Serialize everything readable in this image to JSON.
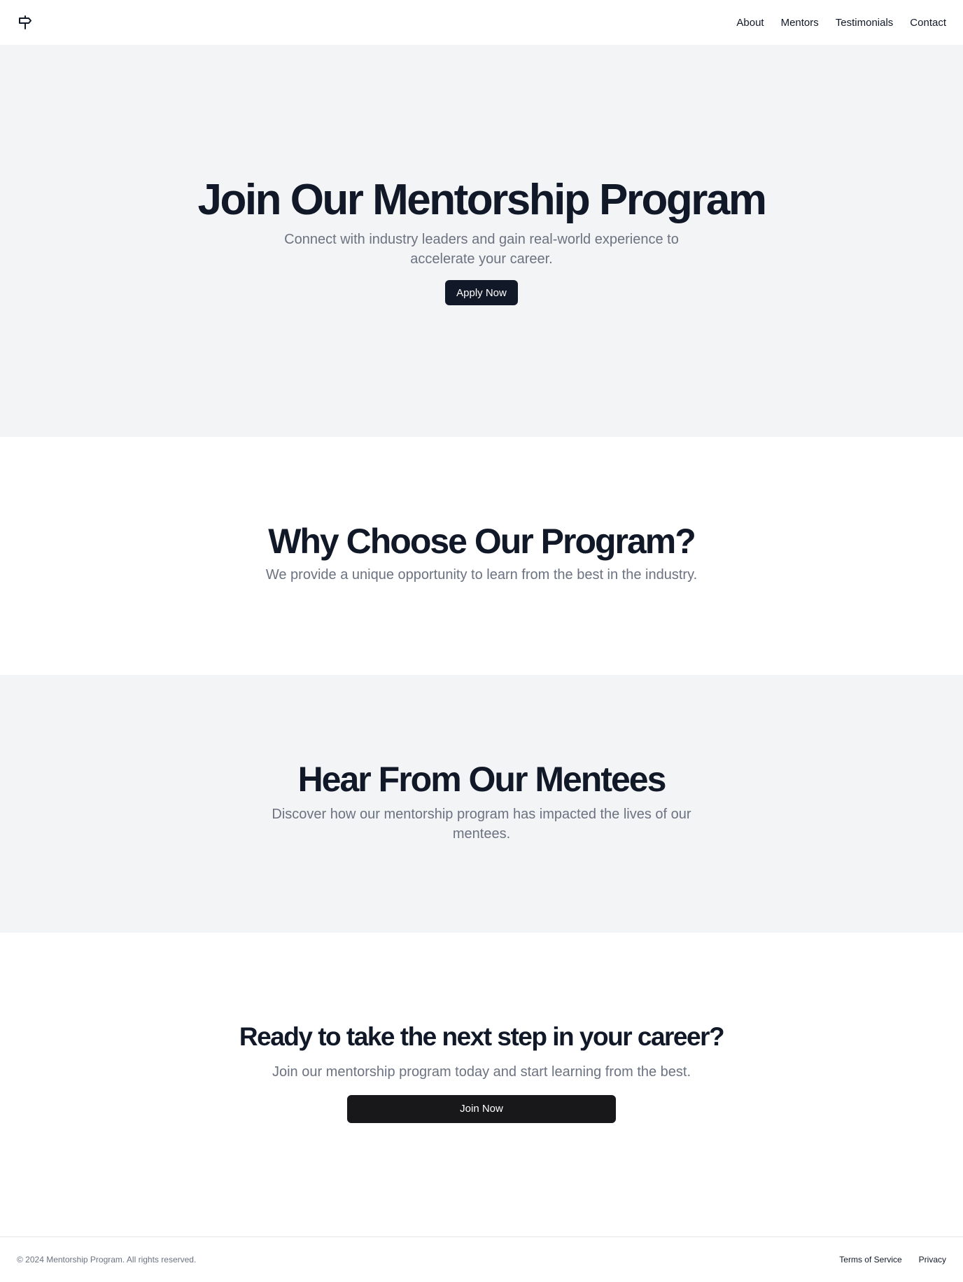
{
  "header": {
    "logo_icon": "signpost-icon",
    "nav": [
      {
        "label": "About"
      },
      {
        "label": "Mentors"
      },
      {
        "label": "Testimonials"
      },
      {
        "label": "Contact"
      }
    ]
  },
  "hero": {
    "title": "Join Our Mentorship Program",
    "subtitle": "Connect with industry leaders and gain real-world experience to accelerate your career.",
    "button_label": "Apply Now"
  },
  "why": {
    "title": "Why Choose Our Program?",
    "subtitle": "We provide a unique opportunity to learn from the best in the industry."
  },
  "mentees": {
    "title": "Hear From Our Mentees",
    "subtitle": "Discover how our mentorship program has impacted the lives of our mentees."
  },
  "cta": {
    "title": "Ready to take the next step in your career?",
    "subtitle": "Join our mentorship program today and start learning from the best.",
    "button_label": "Join Now"
  },
  "footer": {
    "copyright": "© 2024 Mentorship Program. All rights reserved.",
    "links": [
      {
        "label": "Terms of Service"
      },
      {
        "label": "Privacy"
      }
    ]
  },
  "colors": {
    "primary_dark": "#111827",
    "muted_text": "#6b7280",
    "section_gray": "#f3f4f6",
    "border": "#e5e7eb"
  }
}
